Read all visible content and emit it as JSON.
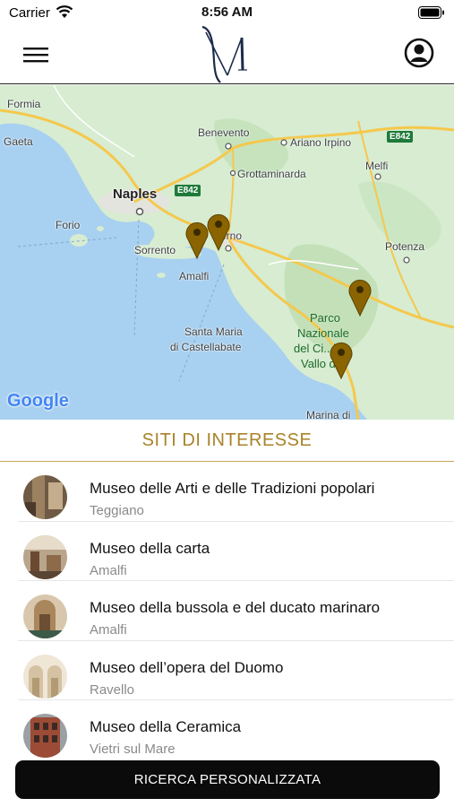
{
  "status_bar": {
    "carrier": "Carrier",
    "time": "8:56 AM",
    "icons": [
      "wifi-icon",
      "battery-icon"
    ]
  },
  "nav_bar": {
    "logo_letter": "M",
    "icons": [
      "menu-icon",
      "profile-icon"
    ]
  },
  "map": {
    "labels": {
      "formia": "Formia",
      "gaeta": "Gaeta",
      "benevento": "Benevento",
      "ariano": "Ariano Irpino",
      "grottaminarda": "Grottaminarda",
      "melfi": "Melfi",
      "naples": "Naples",
      "forio": "Forio",
      "sorrento": "Sorrento",
      "salerno": "erno",
      "amalfi": "Amalfi",
      "potenza": "Potenza",
      "santa_maria": "Santa Maria",
      "castellabate": "di Castellabate",
      "park_1": "Parco",
      "park_2": "Nazionale",
      "park_3": "del Ci...lo,",
      "park_4": "Vallo d...",
      "marina": "Marina di",
      "road_e842_a": "E842",
      "road_e842_b": "E842",
      "google": "Google"
    },
    "pin_count": 4,
    "colors": {
      "sea": "#a8d0f0",
      "land": "#d7ecd1",
      "pin": "#8a6400"
    }
  },
  "section": {
    "title": "SITI DI INTERESSE"
  },
  "poi": [
    {
      "name": "Museo delle Arti e delle Tradizioni popolari",
      "city": "Teggiano"
    },
    {
      "name": "Museo della carta",
      "city": "Amalfi"
    },
    {
      "name": "Museo della bussola e del ducato marinaro",
      "city": "Amalfi"
    },
    {
      "name": "Museo dell’opera del Duomo",
      "city": "Ravello"
    },
    {
      "name": "Museo della Ceramica",
      "city": "Vietri sul Mare"
    }
  ],
  "actions": {
    "search_label": "RICERCA PERSONALIZZATA"
  },
  "theme": {
    "accent": "#a9822a",
    "button_bg": "#0b0b0b"
  }
}
